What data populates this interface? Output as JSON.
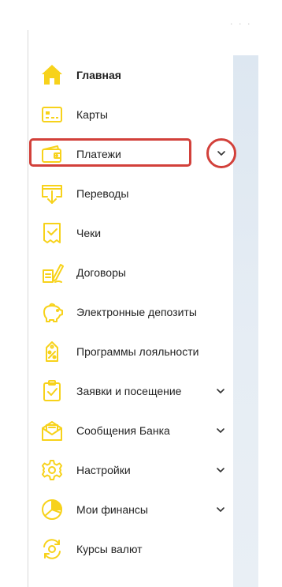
{
  "accent_color": "#f7d21b",
  "highlight_color": "#d2403a",
  "top_fragment_text": "· · ·",
  "menu": [
    {
      "label": "Главная",
      "icon": "home-icon",
      "active": true
    },
    {
      "label": "Карты",
      "icon": "card-icon"
    },
    {
      "label": "Платежи",
      "icon": "wallet-icon",
      "highlighted": true,
      "expandable": true
    },
    {
      "label": "Переводы",
      "icon": "transfer-icon"
    },
    {
      "label": "Чеки",
      "icon": "receipt-icon"
    },
    {
      "label": "Договоры",
      "icon": "contract-icon"
    },
    {
      "label": "Электронные депозиты",
      "icon": "piggy-bank-icon"
    },
    {
      "label": "Программы лояльности",
      "icon": "loyalty-tag-icon"
    },
    {
      "label": "Заявки и посещение",
      "icon": "clipboard-check-icon",
      "expandable": true
    },
    {
      "label": "Сообщения Банка",
      "icon": "mail-icon",
      "expandable": true
    },
    {
      "label": "Настройки",
      "icon": "gear-icon",
      "expandable": true
    },
    {
      "label": "Мои финансы",
      "icon": "pie-chart-icon",
      "expandable": true
    },
    {
      "label": "Курсы валют",
      "icon": "currency-exchange-icon"
    }
  ]
}
